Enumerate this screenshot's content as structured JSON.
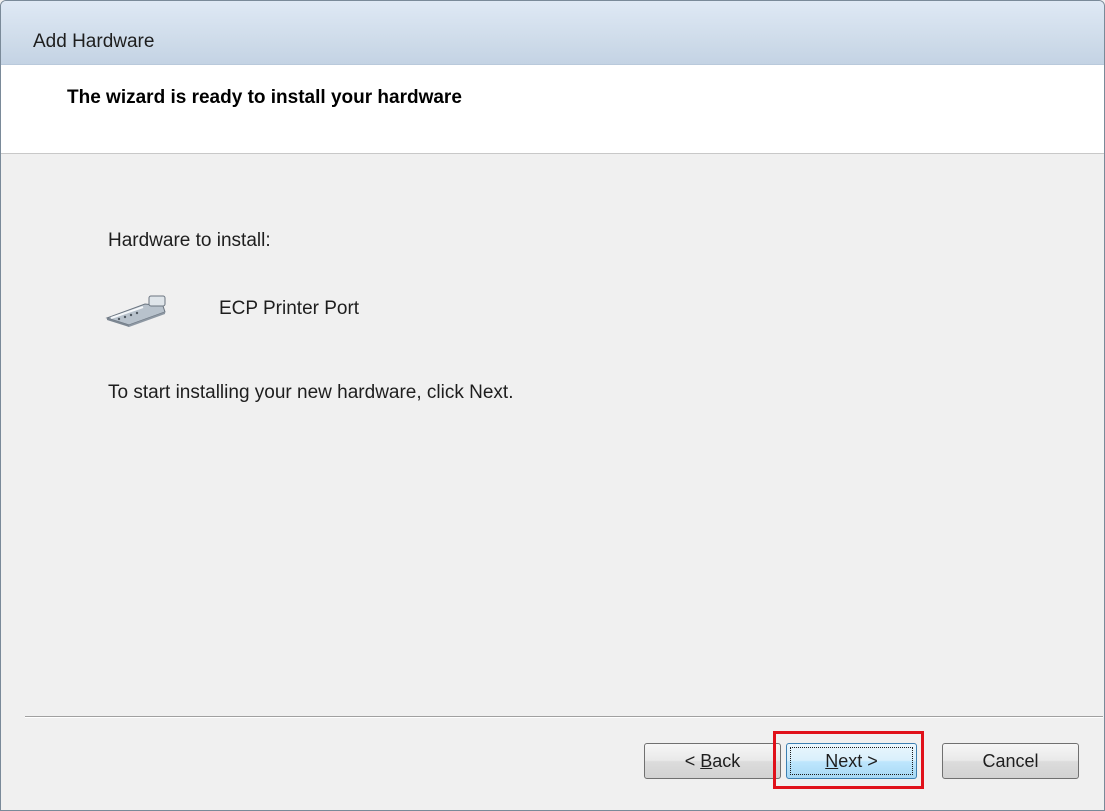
{
  "window": {
    "title": "Add Hardware"
  },
  "header": {
    "title": "The wizard is ready to install your hardware"
  },
  "content": {
    "hardware_label": "Hardware to install:",
    "hardware_icon": "parallel-port-connector-icon",
    "hardware_name": "ECP Printer Port",
    "instruction": "To start installing your new hardware, click Next."
  },
  "buttons": {
    "back": {
      "prefix": "< ",
      "mnemonic": "B",
      "suffix": "ack"
    },
    "next": {
      "prefix": "",
      "mnemonic": "N",
      "suffix": "ext >"
    },
    "cancel": "Cancel"
  },
  "colors": {
    "highlight": "#e0101a",
    "header_bg": "#ffffff",
    "body_bg": "#f0f0f0"
  }
}
